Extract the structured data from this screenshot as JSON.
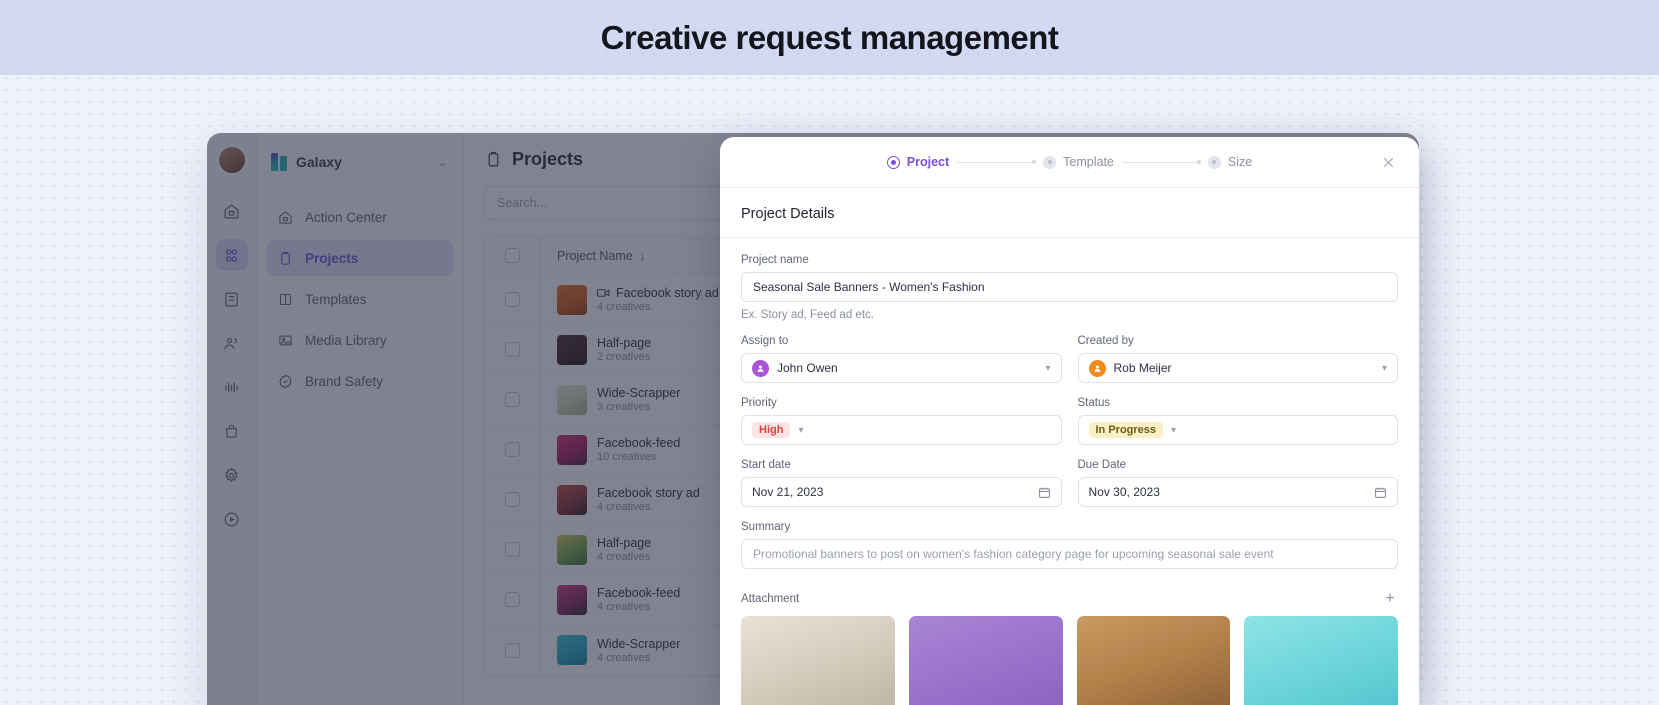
{
  "banner": {
    "title": "Creative request management"
  },
  "rail": {
    "avatar": "user-avatar",
    "icons": [
      {
        "name": "home-icon",
        "active": false
      },
      {
        "name": "projects-icon",
        "active": true
      },
      {
        "name": "templates-icon",
        "active": false
      },
      {
        "name": "people-icon",
        "active": false
      },
      {
        "name": "analytics-icon",
        "active": false
      },
      {
        "name": "bag-icon",
        "active": false
      },
      {
        "name": "settings-icon",
        "active": false
      },
      {
        "name": "play-icon",
        "active": false
      }
    ]
  },
  "sidebar": {
    "workspace": {
      "name": "Galaxy",
      "chevron": "⌄"
    },
    "items": [
      {
        "label": "Action Center",
        "icon": "home-icon",
        "active": false
      },
      {
        "label": "Projects",
        "icon": "clipboard-icon",
        "active": true
      },
      {
        "label": "Templates",
        "icon": "columns-icon",
        "active": false
      },
      {
        "label": "Media Library",
        "icon": "image-icon",
        "active": false
      },
      {
        "label": "Brand Safety",
        "icon": "shield-check-icon",
        "active": false
      }
    ]
  },
  "projects": {
    "title": "Projects",
    "search_placeholder": "Search...",
    "columns": {
      "name": "Project Name",
      "sort": "↓"
    },
    "rows": [
      {
        "title": "Facebook story ad",
        "sub": "4 creatives",
        "video": true,
        "thumb": "linear-gradient(160deg,#e06b18 0%,#c94f0d 60%,#8f3807 100%)"
      },
      {
        "title": "Half-page",
        "sub": "2 creatives",
        "video": false,
        "thumb": "linear-gradient(150deg,#4a2226 0%,#2b1316 70%,#180a0c 100%)"
      },
      {
        "title": "Wide-Scrapper",
        "sub": "3 creatives",
        "video": false,
        "thumb": "linear-gradient(150deg,#e8ecd8 0%,#c9d4b0 50%,#9fae82 100%)"
      },
      {
        "title": "Facebook-feed",
        "sub": "10 creatives",
        "video": false,
        "thumb": "linear-gradient(150deg,#d6246f 0%,#a51253 55%,#3a1430 100%)"
      },
      {
        "title": "Facebook story ad",
        "sub": "4 creatives",
        "video": false,
        "thumb": "linear-gradient(150deg,#c9473b 0%,#8b2a2c 50%,#2a1016 100%)"
      },
      {
        "title": "Half-page",
        "sub": "4 creatives",
        "video": false,
        "thumb": "linear-gradient(150deg,#d9c24a 0%,#6ea23f 55%,#2f6b35 100%)"
      },
      {
        "title": "Facebook-feed",
        "sub": "4 creatives",
        "video": false,
        "thumb": "linear-gradient(150deg,#d92a7a 0%,#7e1d4f 60%,#2b1020 100%)"
      },
      {
        "title": "Wide-Scrapper",
        "sub": "4 creatives",
        "video": false,
        "thumb": "linear-gradient(150deg,#31c4cf 0%,#17a6bd 55%,#0d7d95 100%)"
      }
    ]
  },
  "modal": {
    "steps": [
      {
        "label": "Project",
        "state": "active"
      },
      {
        "label": "Template",
        "state": "idle"
      },
      {
        "label": "Size",
        "state": "idle"
      }
    ],
    "close_icon": "close-icon",
    "section_title": "Project Details",
    "project_name": {
      "label": "Project name",
      "value": "Seasonal Sale Banners - Women's Fashion",
      "helper": "Ex. Story ad, Feed ad etc."
    },
    "assign_to": {
      "label": "Assign to",
      "value": "John Owen",
      "avatar_color": "#a855d6"
    },
    "created_by": {
      "label": "Created by",
      "value": "Rob Meijer",
      "avatar_color": "#f08a1d"
    },
    "priority": {
      "label": "Priority",
      "value": "High"
    },
    "status": {
      "label": "Status",
      "value": "In Progress"
    },
    "start_date": {
      "label": "Start date",
      "value": "Nov 21, 2023"
    },
    "due_date": {
      "label": "Due Date",
      "value": "Nov 30, 2023"
    },
    "summary": {
      "label": "Summary",
      "placeholder": "Promotional banners to post on women's fashion category page for upcoming seasonal sale event"
    },
    "attachment": {
      "label": "Attachment",
      "add_icon": "+",
      "items": [
        {
          "name": "attachment-thumb-1",
          "bg": "linear-gradient(160deg,#e8e2d6 0%,#d8cfc0 45%,#bfb5a4 100%)"
        },
        {
          "name": "attachment-thumb-2",
          "bg": "linear-gradient(160deg,#a885d4 0%,#9b73cc 50%,#8c62c0 100%)"
        },
        {
          "name": "attachment-thumb-3",
          "bg": "linear-gradient(160deg,#c99a63 0%,#b3804a 50%,#8d6138 100%)"
        },
        {
          "name": "attachment-thumb-4",
          "bg": "linear-gradient(160deg,#8fe3e6 0%,#6fd6dc 50%,#53c4cd 100%)"
        }
      ]
    }
  }
}
